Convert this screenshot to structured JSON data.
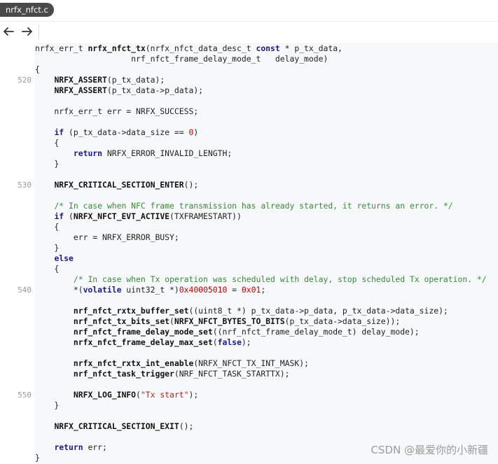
{
  "tab": {
    "label": "nrfx_nfct.c"
  },
  "nav": {
    "back_icon": "arrow-left-icon",
    "forward_icon": "arrow-right-icon"
  },
  "line_numbers": [
    {
      "value": "520",
      "row": 4
    },
    {
      "value": "530",
      "row": 14
    },
    {
      "value": "540",
      "row": 24
    },
    {
      "value": "550",
      "row": 34
    }
  ],
  "code_lines": [
    [
      {
        "t": "nrfx_err_t "
      },
      {
        "t": "nrfx_nfct_tx",
        "c": "fn"
      },
      {
        "t": "(nrfx_nfct_data_desc_t "
      },
      {
        "t": "const",
        "c": "kw"
      },
      {
        "t": " * p_tx_data,"
      }
    ],
    [
      {
        "t": "                    nrf_nfct_frame_delay_mode_t   delay_mode)"
      }
    ],
    [
      {
        "t": "{"
      }
    ],
    [
      {
        "t": "    "
      },
      {
        "t": "NRFX_ASSERT",
        "c": "fn"
      },
      {
        "t": "(p_tx_data);"
      }
    ],
    [
      {
        "t": "    "
      },
      {
        "t": "NRFX_ASSERT",
        "c": "fn"
      },
      {
        "t": "(p_tx_data->p_data);"
      }
    ],
    [
      {
        "t": ""
      }
    ],
    [
      {
        "t": "    nrfx_err_t err = NRFX_SUCCESS;"
      }
    ],
    [
      {
        "t": ""
      }
    ],
    [
      {
        "t": "    "
      },
      {
        "t": "if",
        "c": "kw"
      },
      {
        "t": " (p_tx_data->data_size == "
      },
      {
        "t": "0",
        "c": "num"
      },
      {
        "t": ")"
      }
    ],
    [
      {
        "t": "    {"
      }
    ],
    [
      {
        "t": "        "
      },
      {
        "t": "return",
        "c": "kw"
      },
      {
        "t": " NRFX_ERROR_INVALID_LENGTH;"
      }
    ],
    [
      {
        "t": "    }"
      }
    ],
    [
      {
        "t": ""
      }
    ],
    [
      {
        "t": "    "
      },
      {
        "t": "NRFX_CRITICAL_SECTION_ENTER",
        "c": "fn"
      },
      {
        "t": "();"
      }
    ],
    [
      {
        "t": ""
      }
    ],
    [
      {
        "t": "    "
      },
      {
        "t": "/* In case when NFC frame transmission has already started, it returns an error. */",
        "c": "cmt"
      }
    ],
    [
      {
        "t": "    "
      },
      {
        "t": "if",
        "c": "kw"
      },
      {
        "t": " ("
      },
      {
        "t": "NRFX_NFCT_EVT_ACTIVE",
        "c": "fn"
      },
      {
        "t": "(TXFRAMESTART))"
      }
    ],
    [
      {
        "t": "    {"
      }
    ],
    [
      {
        "t": "        err = NRFX_ERROR_BUSY;"
      }
    ],
    [
      {
        "t": "    }"
      }
    ],
    [
      {
        "t": "    "
      },
      {
        "t": "else",
        "c": "kw"
      }
    ],
    [
      {
        "t": "    {"
      }
    ],
    [
      {
        "t": "        "
      },
      {
        "t": "/* In case when Tx operation was scheduled with delay, stop scheduled Tx operation. */",
        "c": "cmt"
      }
    ],
    [
      {
        "t": "        *("
      },
      {
        "t": "volatile",
        "c": "kw"
      },
      {
        "t": " uint32_t *)"
      },
      {
        "t": "0x40005010",
        "c": "num"
      },
      {
        "t": " = "
      },
      {
        "t": "0x01",
        "c": "num"
      },
      {
        "t": ";"
      }
    ],
    [
      {
        "t": ""
      }
    ],
    [
      {
        "t": "        "
      },
      {
        "t": "nrf_nfct_rxtx_buffer_set",
        "c": "fn"
      },
      {
        "t": "((uint8_t *) p_tx_data->p_data, p_tx_data->data_size);"
      }
    ],
    [
      {
        "t": "        "
      },
      {
        "t": "nrf_nfct_tx_bits_set",
        "c": "fn"
      },
      {
        "t": "("
      },
      {
        "t": "NRFX_NFCT_BYTES_TO_BITS",
        "c": "fn"
      },
      {
        "t": "(p_tx_data->data_size));"
      }
    ],
    [
      {
        "t": "        "
      },
      {
        "t": "nrf_nfct_frame_delay_mode_set",
        "c": "fn"
      },
      {
        "t": "((nrf_nfct_frame_delay_mode_t) delay_mode);"
      }
    ],
    [
      {
        "t": "        "
      },
      {
        "t": "nrfx_nfct_frame_delay_max_set",
        "c": "fn"
      },
      {
        "t": "("
      },
      {
        "t": "false",
        "c": "kw"
      },
      {
        "t": ");"
      }
    ],
    [
      {
        "t": ""
      }
    ],
    [
      {
        "t": "        "
      },
      {
        "t": "nrfx_nfct_rxtx_int_enable",
        "c": "fn"
      },
      {
        "t": "(NRFX_NFCT_TX_INT_MASK);"
      }
    ],
    [
      {
        "t": "        "
      },
      {
        "t": "nrf_nfct_task_trigger",
        "c": "fn"
      },
      {
        "t": "(NRF_NFCT_TASK_STARTTX);"
      }
    ],
    [
      {
        "t": ""
      }
    ],
    [
      {
        "t": "        "
      },
      {
        "t": "NRFX_LOG_INFO",
        "c": "fn"
      },
      {
        "t": "("
      },
      {
        "t": "\"Tx start\"",
        "c": "str"
      },
      {
        "t": ");"
      }
    ],
    [
      {
        "t": "    }"
      }
    ],
    [
      {
        "t": ""
      }
    ],
    [
      {
        "t": "    "
      },
      {
        "t": "NRFX_CRITICAL_SECTION_EXIT",
        "c": "fn"
      },
      {
        "t": "();"
      }
    ],
    [
      {
        "t": ""
      }
    ],
    [
      {
        "t": "    "
      },
      {
        "t": "return",
        "c": "kw"
      },
      {
        "t": " err;"
      }
    ],
    [
      {
        "t": "}"
      }
    ]
  ],
  "watermark": "CSDN @最爱你的小新疆"
}
